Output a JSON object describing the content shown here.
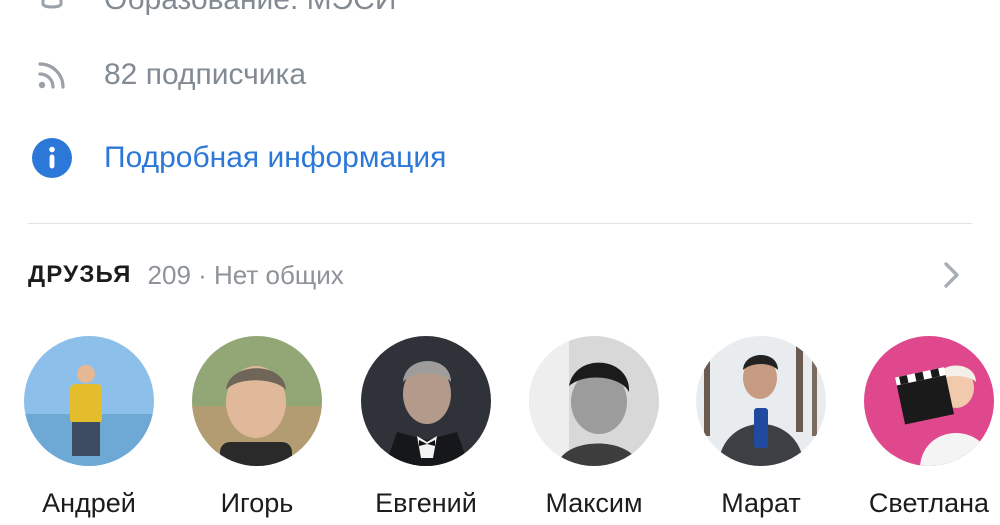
{
  "profile_info": {
    "education": "Образование: МЭСИ",
    "followers": "82 подписчика",
    "more_info_link": "Подробная информация"
  },
  "friends": {
    "title": "ДРУЗЬЯ",
    "meta": "209 · Нет общих",
    "list": [
      {
        "name": "Андрей"
      },
      {
        "name": "Игорь"
      },
      {
        "name": "Евгений"
      },
      {
        "name": "Максим"
      },
      {
        "name": "Марат"
      },
      {
        "name": "Светлана"
      }
    ]
  },
  "colors": {
    "link": "#2b78d8",
    "secondary_text": "#828a93",
    "info_icon": "#2b78d8"
  },
  "icons": {
    "education": "graduation-cap-icon",
    "followers": "rss-icon",
    "info": "info-circle-icon",
    "friends_more": "chevron-right-icon"
  }
}
